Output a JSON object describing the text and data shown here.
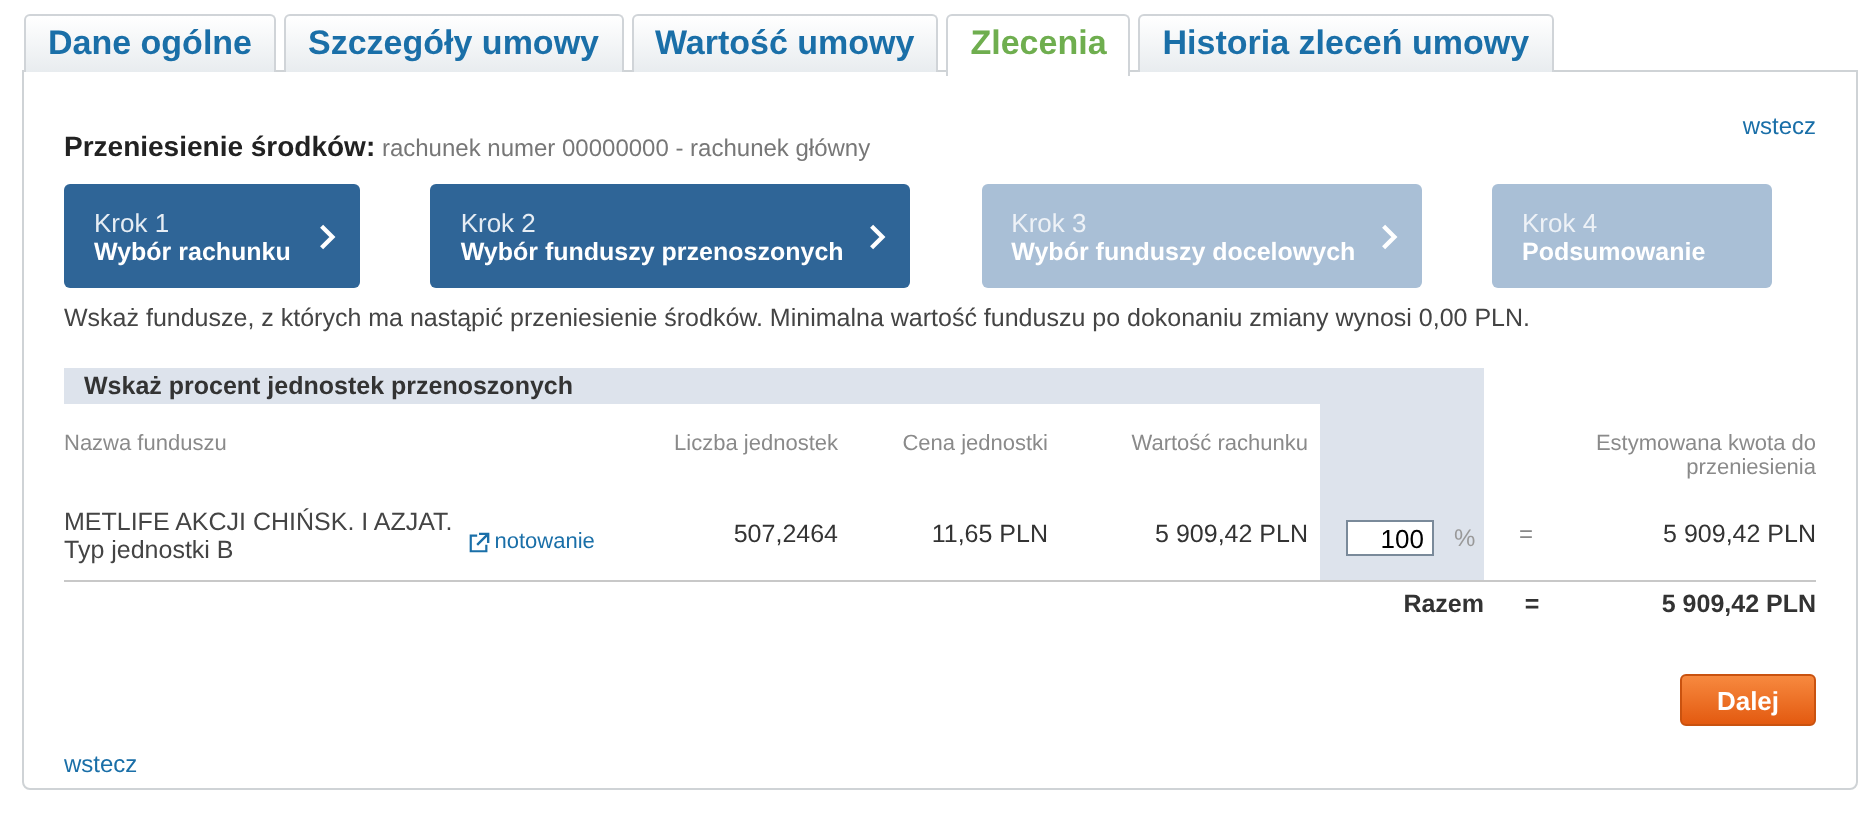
{
  "tabs": [
    {
      "label": "Dane ogólne",
      "selected": false
    },
    {
      "label": "Szczegóły umowy",
      "selected": false
    },
    {
      "label": "Wartość umowy",
      "selected": false
    },
    {
      "label": "Zlecenia",
      "selected": true
    },
    {
      "label": "Historia zleceń umowy",
      "selected": false
    }
  ],
  "back_link_top": "wstecz",
  "heading": {
    "title": "Przeniesienie środków:",
    "subtitle": "rachunek numer 00000000 - rachunek główny"
  },
  "steps": [
    {
      "number": "Krok 1",
      "label": "Wybór rachunku",
      "active": true,
      "arrow": true
    },
    {
      "number": "Krok 2",
      "label": "Wybór funduszy przenoszonych",
      "active": true,
      "arrow": true
    },
    {
      "number": "Krok 3",
      "label": "Wybór funduszy docelowych",
      "active": false,
      "arrow": true
    },
    {
      "number": "Krok 4",
      "label": "Podsumowanie",
      "active": false,
      "arrow": false
    }
  ],
  "instruction": "Wskaż fundusze, z których ma nastąpić przeniesienie środków. Minimalna wartość funduszu po dokonaniu zmiany wynosi 0,00 PLN.",
  "table": {
    "section_title": "Wskaż procent jednostek przenoszonych",
    "columns": [
      "Nazwa funduszu",
      "Liczba jednostek",
      "Cena jednostki",
      "Wartość rachunku",
      "Estymowana kwota do przeniesienia"
    ],
    "rows": [
      {
        "fund": "METLIFE AKCJI CHIŃSK. I AZJAT.",
        "unit_type": "Typ jednostki B",
        "link": "notowanie",
        "units": "507,2464",
        "price": "11,65 PLN",
        "value": "5 909,42 PLN",
        "percent": "100",
        "percent_sign": "%",
        "equals": "=",
        "amount": "5 909,42 PLN"
      }
    ],
    "total": {
      "label": "Razem",
      "equals": "=",
      "amount": "5 909,42 PLN"
    }
  },
  "next_button": "Dalej",
  "back_link_bottom": "wstecz"
}
